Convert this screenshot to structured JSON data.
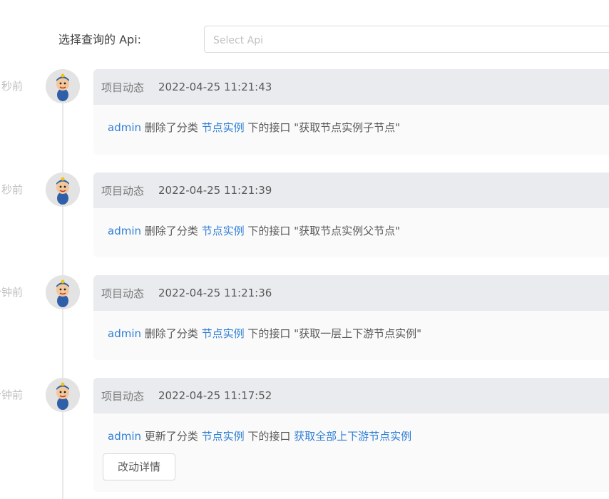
{
  "filter": {
    "label": "选择查询的 Api:",
    "placeholder": "Select Api"
  },
  "entries": [
    {
      "ago": "秒前",
      "type": "项目动态",
      "date": "2022-04-25 11:21:43",
      "user": "admin",
      "verb": "删除了分类",
      "category": "节点实例",
      "mid": "下的接口",
      "target": "\"获取节点实例子节点\""
    },
    {
      "ago": "秒前",
      "type": "项目动态",
      "date": "2022-04-25 11:21:39",
      "user": "admin",
      "verb": "删除了分类",
      "category": "节点实例",
      "mid": "下的接口",
      "target": "\"获取节点实例父节点\""
    },
    {
      "ago": "分钟前",
      "type": "项目动态",
      "date": "2022-04-25 11:21:36",
      "user": "admin",
      "verb": "删除了分类",
      "category": "节点实例",
      "mid": "下的接口",
      "target": "\"获取一层上下游节点实例\""
    },
    {
      "ago": "分钟前",
      "type": "项目动态",
      "date": "2022-04-25 11:17:52",
      "user": "admin",
      "verb": "更新了分类",
      "category": "节点实例",
      "mid": "下的接口",
      "target": "获取全部上下游节点实例",
      "button": "改动详情"
    }
  ],
  "colors": {
    "link": "#2f7fd6",
    "card_header": "#eaebee",
    "card_body": "#fafafa"
  }
}
